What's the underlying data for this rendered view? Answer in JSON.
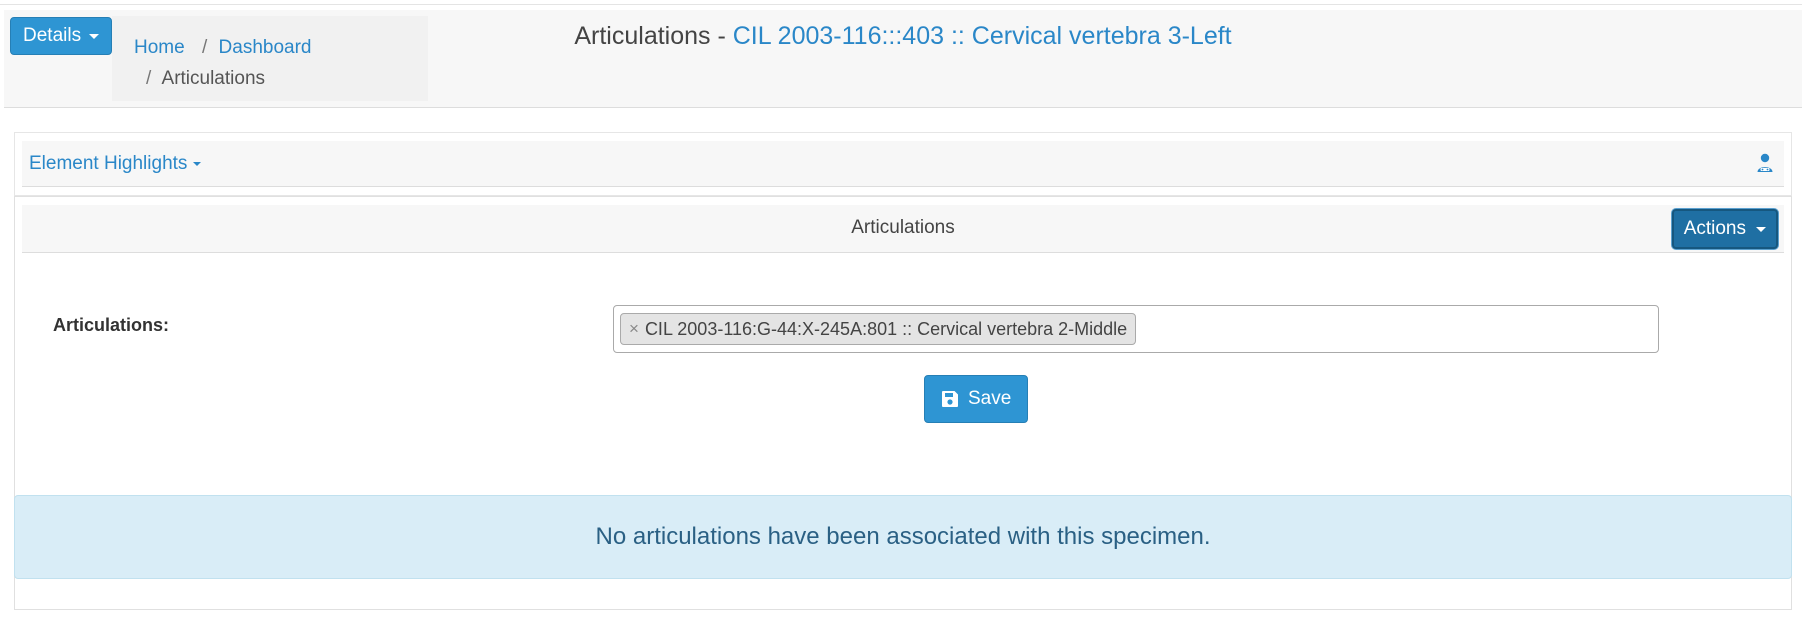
{
  "header": {
    "details_label": "Details",
    "breadcrumb": {
      "home": "Home",
      "dashboard": "Dashboard",
      "current": "Articulations",
      "separator": "/"
    },
    "title_prefix": "Articulations - ",
    "title_link": "CIL 2003-116:::403 :: Cervical vertebra 3-Left"
  },
  "highlights": {
    "label": "Element Highlights",
    "icon": "user-icon"
  },
  "panel": {
    "title": "Articulations",
    "actions_label": "Actions",
    "field_label": "Articulations:",
    "selected_items": [
      {
        "remove_symbol": "×",
        "label": "CIL 2003-116:G-44:X-245A:801 :: Cervical vertebra 2-Middle"
      }
    ],
    "save_label": "Save",
    "save_icon": "floppy-disk-icon",
    "alert_text": "No articulations have been associated with this specimen."
  },
  "colors": {
    "primary": "#2e95d3",
    "link": "#2a87c8",
    "actions": "#1f6fa3",
    "alert_bg": "#d9edf7",
    "alert_text": "#2a6084"
  }
}
